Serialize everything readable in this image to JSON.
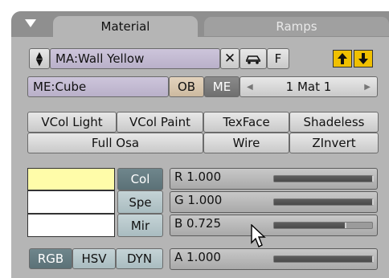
{
  "tabs": {
    "material": "Material",
    "ramps": "Ramps"
  },
  "material_block": {
    "name": "MA:Wall Yellow",
    "fake_user": "F"
  },
  "mesh_block": {
    "mesh_name": "ME:Cube",
    "ob_label": "OB",
    "me_label": "ME",
    "mat_index": "1 Mat 1"
  },
  "options_row1": [
    "VCol Light",
    "VCol Paint",
    "TexFace",
    "Shadeless"
  ],
  "options_row2": [
    "Full Osa",
    "Wire",
    "ZInvert"
  ],
  "color_buttons": [
    "Col",
    "Spe",
    "Mir"
  ],
  "color_model": [
    "RGB",
    "HSV",
    "DYN"
  ],
  "sliders": {
    "r": {
      "label": "R 1.000",
      "value": 1.0
    },
    "g": {
      "label": "G 1.000",
      "value": 1.0
    },
    "b": {
      "label": "B 0.725",
      "value": 0.725
    },
    "a": {
      "label": "A 1.000",
      "value": 1.0
    }
  },
  "swatch_colors": {
    "col": "#fffca9",
    "spe": "#ffffff",
    "mir": "#ffffff"
  },
  "icons": {
    "collapse": "collapse-triangle-icon",
    "browse": "up-down-arrows-icon",
    "delete": "x-icon",
    "car": "car-icon",
    "move_up": "arrow-up-icon",
    "move_down": "arrow-down-icon",
    "cursor": "mouse-cursor-icon"
  }
}
